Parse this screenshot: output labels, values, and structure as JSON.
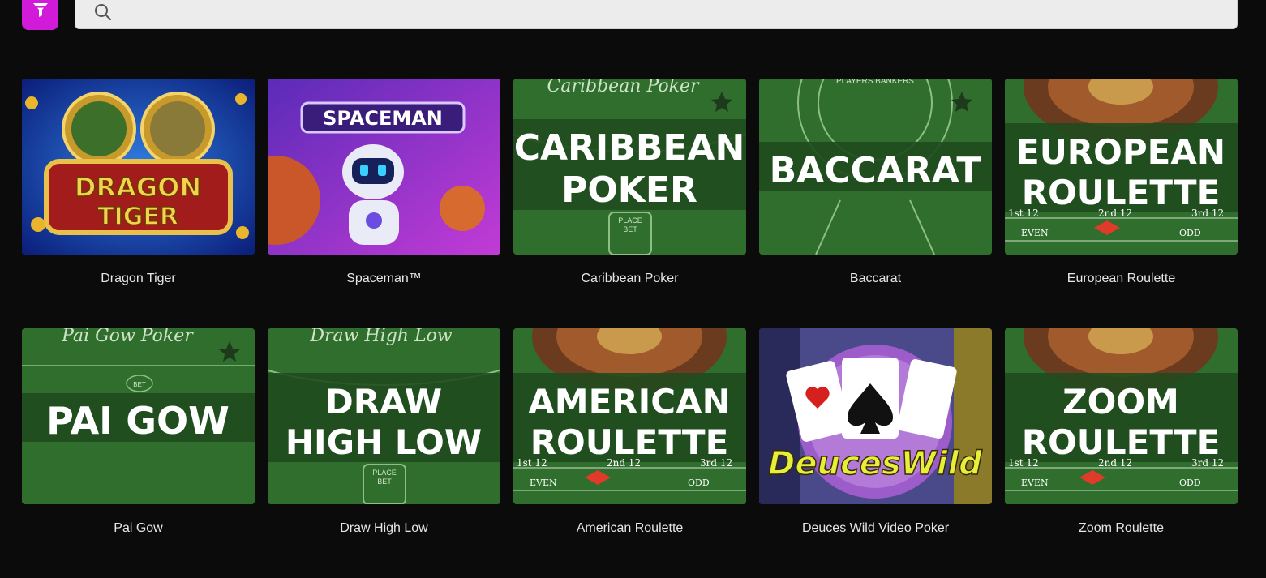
{
  "search": {
    "placeholder": "",
    "value": ""
  },
  "colors": {
    "accent": "#d21ad9",
    "felt": "#2e6b2c",
    "background": "#0b0b0b"
  },
  "games": [
    {
      "title": "Dragon Tiger",
      "art_lines": [
        "DRAGON",
        "TIGER"
      ]
    },
    {
      "title": "Spaceman™",
      "art_lines": [
        "SPACEMAN"
      ]
    },
    {
      "title": "Caribbean Poker",
      "art_lines": [
        "CARIBBEAN",
        "POKER"
      ],
      "header": "Caribbean Poker",
      "sub": [
        "PLACE",
        "BET"
      ]
    },
    {
      "title": "Baccarat",
      "art_lines": [
        "BACCARAT"
      ],
      "header": "PLAYERS  BANKERS"
    },
    {
      "title": "European Roulette",
      "art_lines": [
        "EUROPEAN",
        "ROULETTE"
      ],
      "bet_row": [
        "1st 12",
        "2nd 12",
        "3rd 12"
      ],
      "bet_row2": [
        "EVEN",
        "ODD"
      ]
    },
    {
      "title": "Pai Gow",
      "art_lines": [
        "PAI GOW"
      ],
      "header": "Pai Gow Poker",
      "sub": [
        "BET"
      ]
    },
    {
      "title": "Draw High Low",
      "art_lines": [
        "DRAW",
        "HIGH LOW"
      ],
      "header": "Draw High Low",
      "sub": [
        "PLACE",
        "BET"
      ]
    },
    {
      "title": "American Roulette",
      "art_lines": [
        "AMERICAN",
        "ROULETTE"
      ],
      "bet_row": [
        "1st 12",
        "2nd 12",
        "3rd 12"
      ],
      "bet_row2": [
        "EVEN",
        "ODD"
      ]
    },
    {
      "title": "Deuces Wild Video Poker",
      "art_lines": [
        "DeucesWild"
      ]
    },
    {
      "title": "Zoom Roulette",
      "art_lines": [
        "ZOOM",
        "ROULETTE"
      ],
      "bet_row": [
        "1st 12",
        "2nd 12",
        "3rd 12"
      ],
      "bet_row2": [
        "EVEN",
        "ODD"
      ]
    }
  ]
}
